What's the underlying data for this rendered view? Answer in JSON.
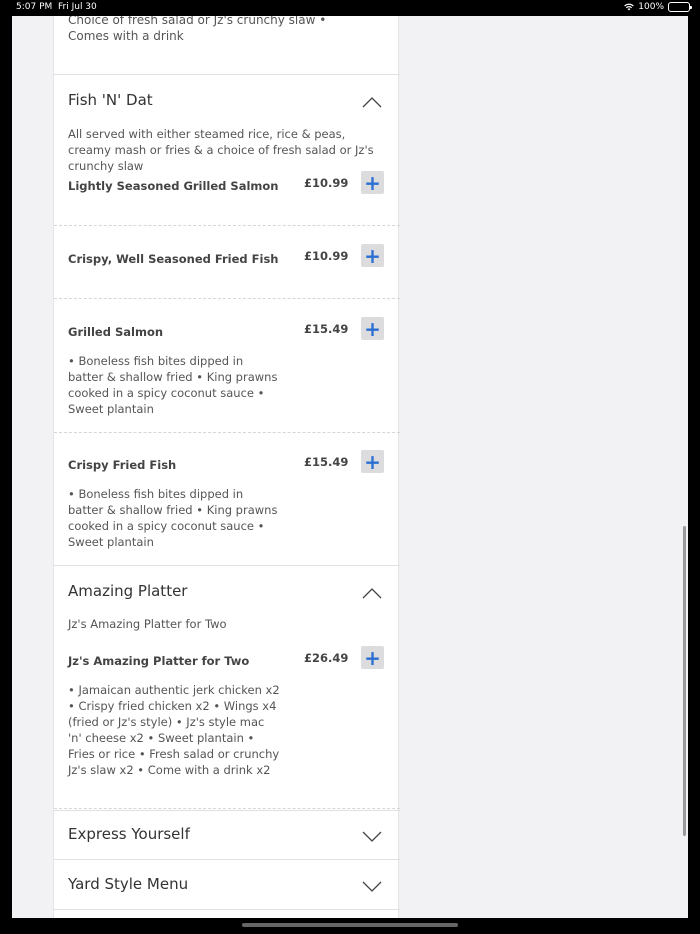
{
  "status": {
    "time": "5:07 PM",
    "date": "Fri Jul 30",
    "battery": "100%"
  },
  "top_text": "Choice of fresh salad or Jz's crunchy slaw • Comes with a drink",
  "sections": [
    {
      "title": "Fish 'N' Dat",
      "expanded": true,
      "description": "All served with either steamed rice, rice & peas, creamy mash or fries & a choice of fresh salad or Jz's crunchy slaw",
      "items": [
        {
          "name": "Lightly Seasoned Grilled Salmon",
          "price": "£10.99",
          "description": ""
        },
        {
          "name": "Crispy, Well Seasoned Fried Fish",
          "price": "£10.99",
          "description": ""
        },
        {
          "name": "Grilled Salmon",
          "price": "£15.49",
          "description": "• Boneless fish bites dipped in batter & shallow fried • King prawns cooked in a spicy coconut sauce • Sweet plantain"
        },
        {
          "name": "Crispy Fried Fish",
          "price": "£15.49",
          "description": "• Boneless fish bites dipped in batter & shallow fried • King prawns cooked in a spicy coconut sauce • Sweet plantain"
        }
      ]
    },
    {
      "title": "Amazing Platter",
      "expanded": true,
      "description": "Jz's Amazing Platter for Two",
      "items": [
        {
          "name": "Jz's Amazing Platter for Two",
          "price": "£26.49",
          "description": "• Jamaican authentic jerk chicken x2 • Crispy fried chicken x2 • Wings x4 (fried or Jz's style) • Jz's style mac 'n' cheese x2 • Sweet plantain • Fries or rice • Fresh salad or crunchy Jz's slaw x2 • Come with a drink x2"
        }
      ]
    },
    {
      "title": "Express Yourself",
      "expanded": false
    },
    {
      "title": "Yard Style Menu",
      "expanded": false
    }
  ],
  "add_label": "+",
  "colors": {
    "accent": "#2a6fd1",
    "add_button_bg": "#dcdcde",
    "page_bg": "#f2f2f4"
  }
}
